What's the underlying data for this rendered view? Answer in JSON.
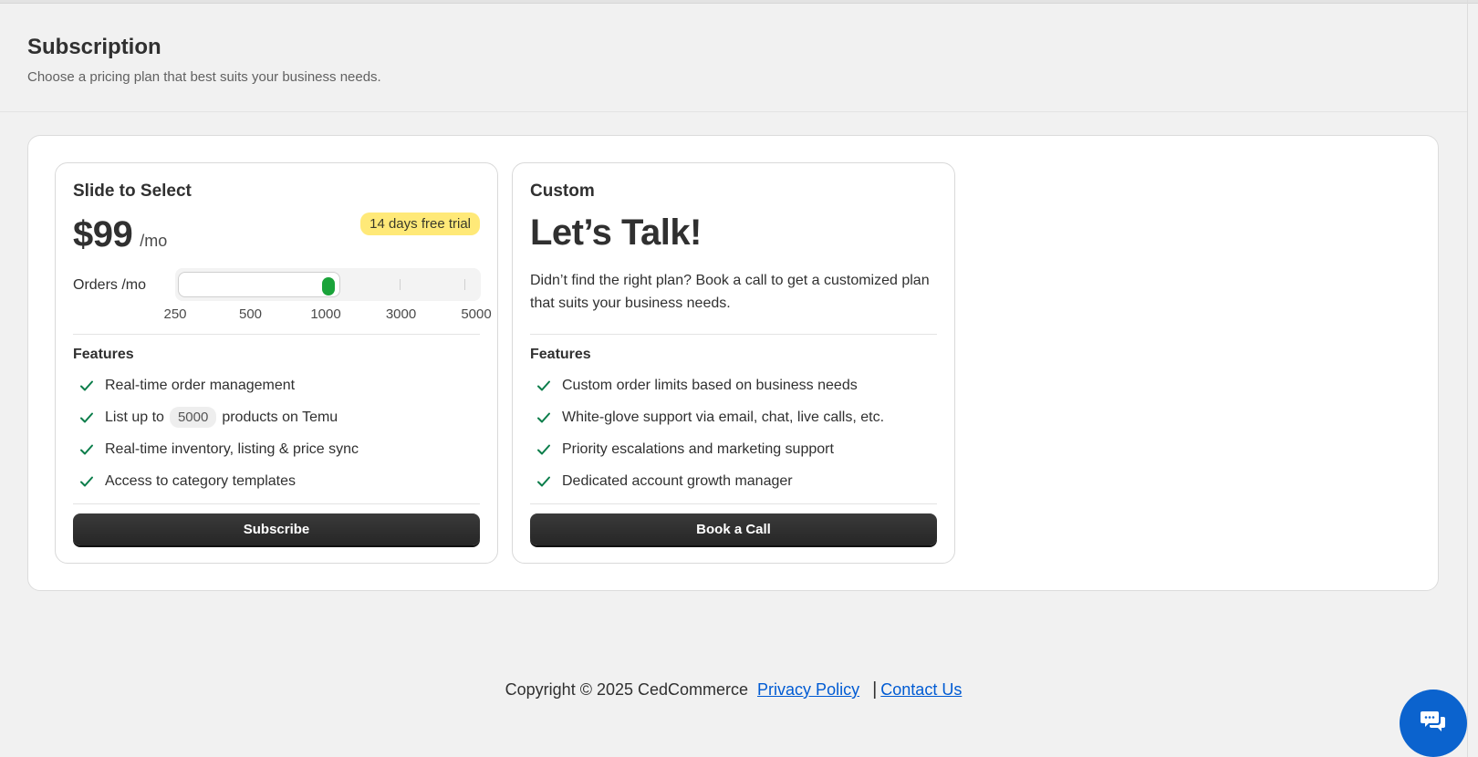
{
  "header": {
    "title": "Subscription",
    "subtitle": "Choose a pricing plan that best suits your business needs."
  },
  "plans": [
    {
      "name": "Slide to Select",
      "price": "$99",
      "period": "/mo",
      "trial_badge": "14 days free trial",
      "orders_label": "Orders /mo",
      "slider": {
        "ticks": [
          "250",
          "500",
          "1000",
          "3000",
          "5000"
        ],
        "selected_value": "1000",
        "selected_fraction": 0.5
      },
      "features_title": "Features",
      "features": {
        "f1": "Real-time order management",
        "f2_prefix": "List up to",
        "f2_count": "5000",
        "f2_suffix": "products on Temu",
        "f3": "Real-time inventory, listing & price sync",
        "f4": "Access to category templates"
      },
      "cta": "Subscribe"
    },
    {
      "name": "Custom",
      "headline": "Let’s Talk!",
      "description": "Didn’t find the right plan? Book a call to get a customized plan that suits your business needs.",
      "features_title": "Features",
      "features": [
        "Custom order limits based on business needs",
        "White-glove support via email, chat, live calls, etc.",
        "Priority escalations and marketing support",
        "Dedicated account growth manager"
      ],
      "cta": "Book a Call"
    }
  ],
  "footer": {
    "copyright": "Copyright © 2025 CedCommerce",
    "privacy": "Privacy Policy",
    "separator": "|",
    "contact": "Contact Us"
  },
  "colors": {
    "accent_green": "#1aa33a",
    "check_green": "#0a7d4a",
    "badge_yellow": "#ffe978",
    "link_blue": "#005bd3",
    "chat_blue": "#0b63ce"
  },
  "icons": {
    "check": "check-icon",
    "chat": "chat-icon"
  }
}
